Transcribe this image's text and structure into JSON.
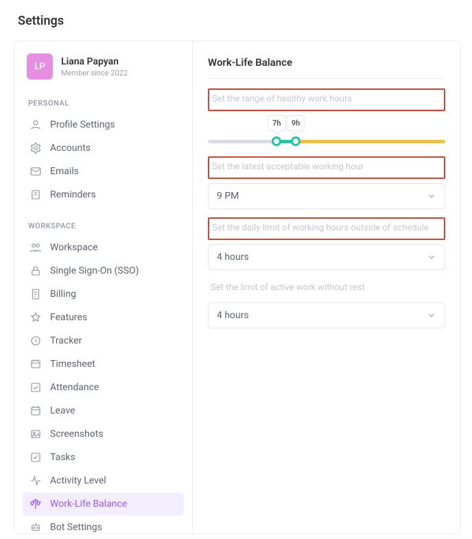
{
  "page_title": "Settings",
  "profile": {
    "initials": "LP",
    "name": "Liana Papyan",
    "sub": "Member since 2022"
  },
  "sections": {
    "personal": "PERSONAL",
    "workspace": "WORKSPACE"
  },
  "nav": {
    "profile_settings": "Profile Settings",
    "accounts": "Accounts",
    "emails": "Emails",
    "reminders": "Reminders",
    "workspace": "Workspace",
    "sso": "Single Sign-On (SSO)",
    "billing": "Billing",
    "features": "Features",
    "tracker": "Tracker",
    "timesheet": "Timesheet",
    "attendance": "Attendance",
    "leave": "Leave",
    "screenshots": "Screenshots",
    "tasks": "Tasks",
    "activity": "Activity Level",
    "wlb": "Work-Life Balance",
    "bot": "Bot Settings"
  },
  "main": {
    "title": "Work-Life Balance",
    "hint_range": "Set the range of healthy work hours",
    "slider_low": "7h",
    "slider_high": "9h",
    "hint_latest": "Set the latest acceptable working hour",
    "latest_value": "9 PM",
    "hint_outside": "Set the daily limit of working hours outside of schedule",
    "outside_value": "4 hours",
    "hint_rest": "Set the limit of active work without rest",
    "rest_value": "4 hours"
  }
}
